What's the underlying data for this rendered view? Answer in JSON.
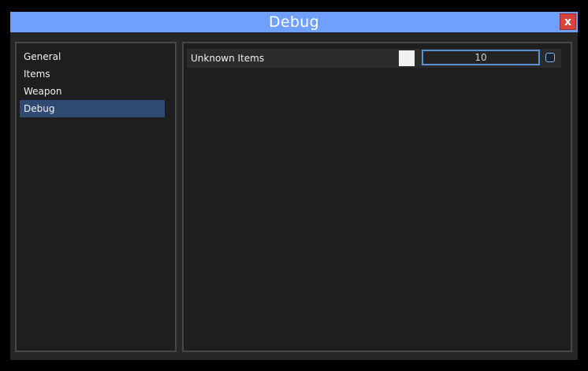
{
  "window": {
    "title": "Debug",
    "close_label": "x"
  },
  "sidebar": {
    "items": [
      {
        "label": "General"
      },
      {
        "label": "Items"
      },
      {
        "label": "Weapon"
      },
      {
        "label": "Debug",
        "active": true
      }
    ]
  },
  "content": {
    "rows": [
      {
        "label": "Unknown Items",
        "swatch_color": "#f0f0f0",
        "value": "10",
        "checked": false
      }
    ]
  },
  "colors": {
    "titlebar": "#6fa0ff",
    "close": "#d5443e",
    "active_item": "#2e4a72",
    "input_border": "#5b8fd6"
  },
  "icons": {
    "close": "close-icon",
    "checkbox": "checkbox-icon"
  }
}
